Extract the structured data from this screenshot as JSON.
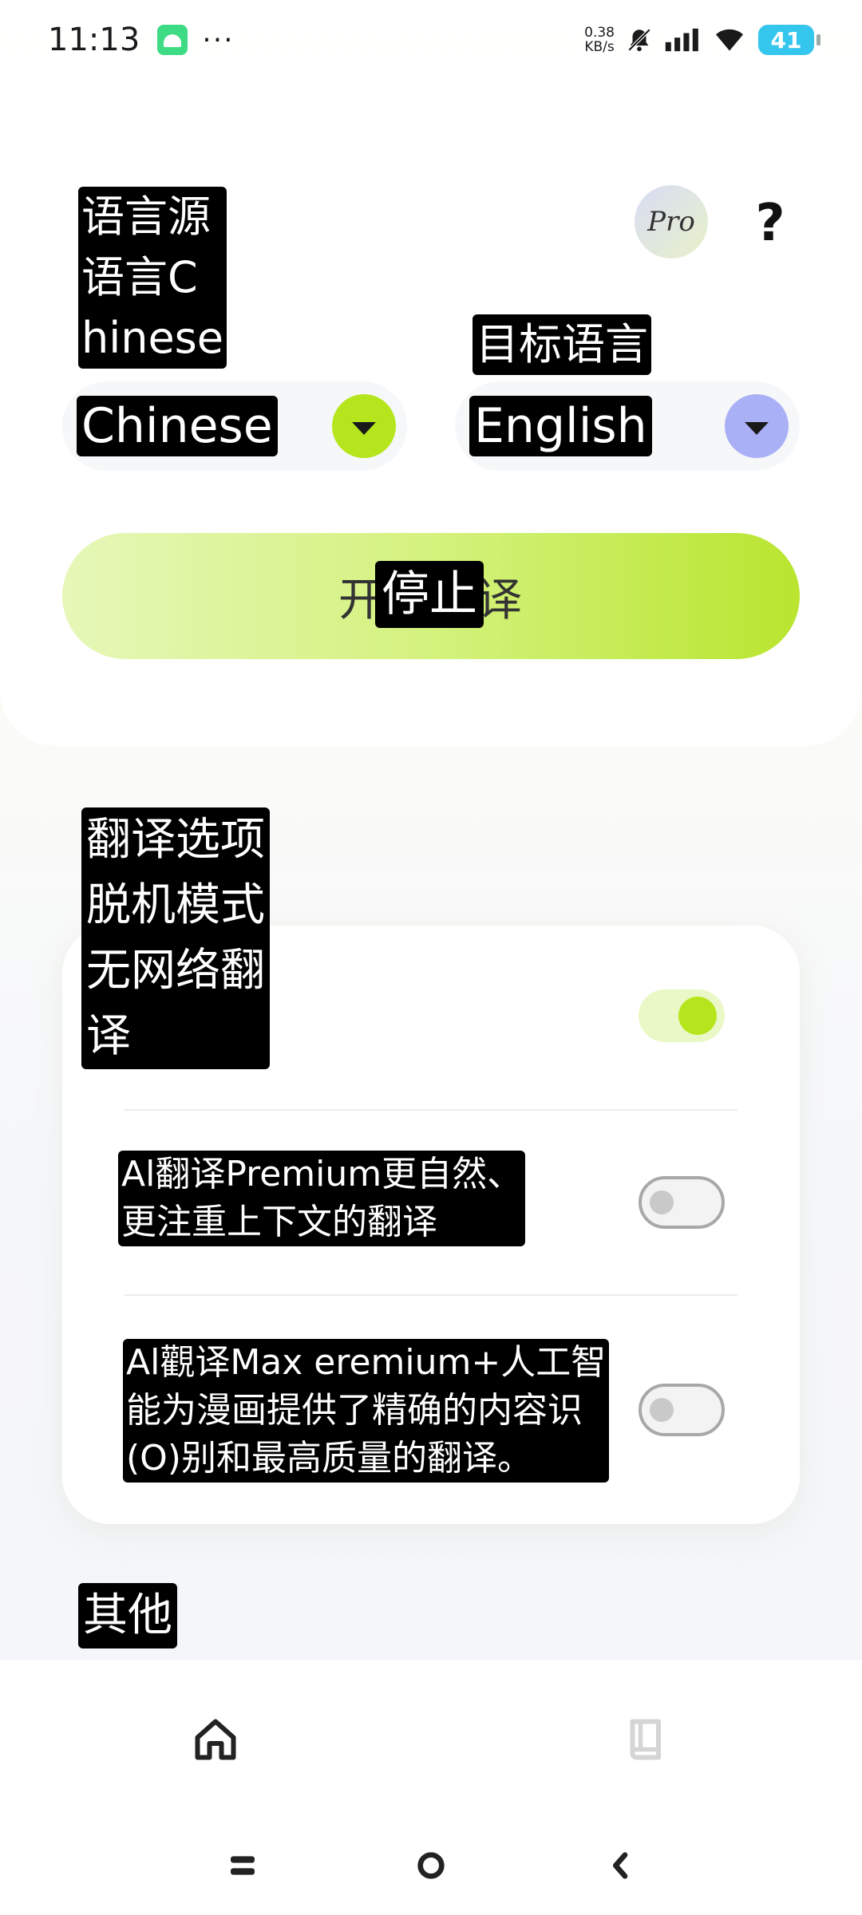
{
  "status_bar": {
    "time": "11:13",
    "dots": "···",
    "speed_value": "0.38",
    "speed_unit": "KB/s",
    "battery": "41"
  },
  "header": {
    "source_label": "语言源\n语言C\nhinese",
    "target_label": "目标语言",
    "pro_label": "Pro",
    "help_label": "?"
  },
  "languages": {
    "source_value": "Chinese",
    "target_value": "English",
    "source_arrow_color": "#b5e61d",
    "target_arrow_color": "#aab0f5"
  },
  "action": {
    "underlying_label": "开始翻译",
    "overlay_label": "停止"
  },
  "options_section": {
    "title": "翻译选项\n脱机模式\n无网络翻\n译",
    "items": [
      {
        "label": "",
        "enabled": true
      },
      {
        "label": "Al翻译Premium更自然、\n更注重上下文的翻译",
        "enabled": false
      },
      {
        "label": "Al觀译Max eremium+人工智\n能为漫画提供了精确的内容识\n(O)别和最高质量的翻译。",
        "enabled": false
      }
    ]
  },
  "other_section": {
    "title": "其他"
  },
  "nav": {
    "home_icon": "home-icon",
    "book_icon": "book-icon"
  },
  "colors": {
    "accent_green": "#b5e61d",
    "accent_purple": "#aab0f5"
  }
}
